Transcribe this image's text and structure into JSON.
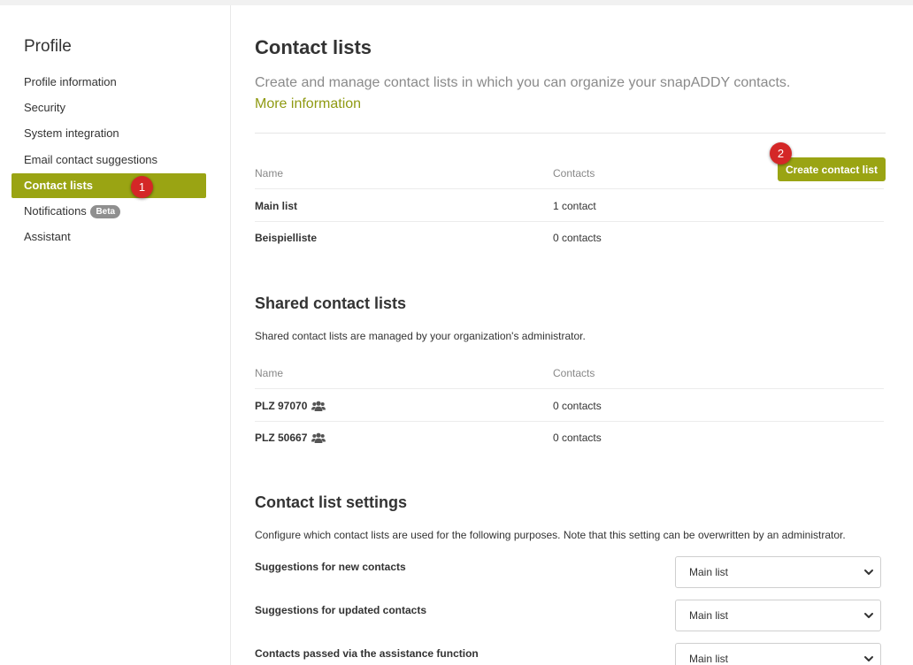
{
  "sidebar": {
    "title": "Profile",
    "items": [
      {
        "label": "Profile information"
      },
      {
        "label": "Security"
      },
      {
        "label": "System integration"
      },
      {
        "label": "Email contact suggestions"
      },
      {
        "label": "Contact lists"
      },
      {
        "label": "Notifications",
        "badge": "Beta"
      },
      {
        "label": "Assistant"
      }
    ],
    "active_marker": "1"
  },
  "contact_lists": {
    "title": "Contact lists",
    "description": "Create and manage contact lists in which you can organize your snapADDY contacts.",
    "more_link": "More information",
    "create_button": "Create contact list",
    "create_marker": "2",
    "columns": [
      "Name",
      "Contacts"
    ],
    "rows": [
      {
        "name": "Main list",
        "contacts": "1 contact"
      },
      {
        "name": "Beispielliste",
        "contacts": "0 contacts"
      }
    ]
  },
  "shared": {
    "title": "Shared contact lists",
    "description": "Shared contact lists are managed by your organization's administrator.",
    "columns": [
      "Name",
      "Contacts"
    ],
    "rows": [
      {
        "name": "PLZ 97070",
        "contacts": "0 contacts",
        "icon": "users-icon"
      },
      {
        "name": "PLZ 50667",
        "contacts": "0 contacts",
        "icon": "users-icon"
      }
    ]
  },
  "settings": {
    "title": "Contact list settings",
    "description": "Configure which contact lists are used for the following purposes. Note that this setting can be overwritten by an administrator.",
    "items": [
      {
        "label": "Suggestions for new contacts",
        "value": "Main list"
      },
      {
        "label": "Suggestions for updated contacts",
        "value": "Main list"
      },
      {
        "label": "Contacts passed via the assistance function",
        "value": "Main list"
      }
    ]
  },
  "colors": {
    "accent": "#9aa413",
    "link": "#8f9a12",
    "marker": "#d42727"
  }
}
